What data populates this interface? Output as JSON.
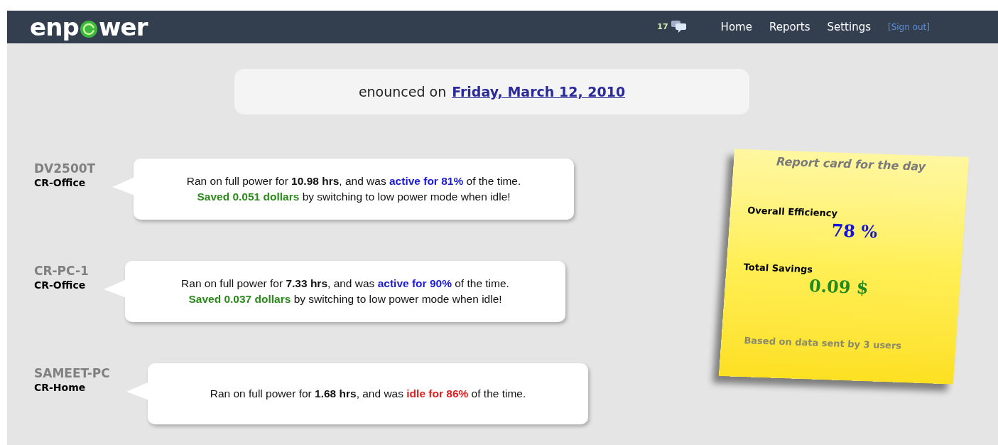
{
  "logo": {
    "before": "enp",
    "after": "wer"
  },
  "nav": {
    "message_count": "17",
    "links": [
      {
        "label": "Home",
        "kind": "main"
      },
      {
        "label": "Reports",
        "kind": "main"
      },
      {
        "label": "Settings",
        "kind": "main"
      },
      {
        "label": "[Sign out]",
        "kind": "signout"
      }
    ]
  },
  "date_banner": {
    "prefix": "enounced on",
    "date": "Friday, March 12, 2010"
  },
  "devices": [
    {
      "name": "DV2500T",
      "location": "CR-Office",
      "lines": [
        [
          {
            "kind": "plain",
            "text": "Ran on full power for "
          },
          {
            "kind": "bold",
            "text": "10.98 hrs"
          },
          {
            "kind": "plain",
            "text": ", and was "
          },
          {
            "kind": "active",
            "text": "active for 81%"
          },
          {
            "kind": "plain",
            "text": " of the time."
          }
        ],
        [
          {
            "kind": "saved",
            "text": "Saved 0.051 dollars"
          },
          {
            "kind": "plain",
            "text": " by switching to low power mode when idle!"
          }
        ]
      ]
    },
    {
      "name": "CR-PC-1",
      "location": "CR-Office",
      "lines": [
        [
          {
            "kind": "plain",
            "text": "Ran on full power for "
          },
          {
            "kind": "bold",
            "text": "7.33 hrs"
          },
          {
            "kind": "plain",
            "text": ", and was "
          },
          {
            "kind": "active",
            "text": "active for 90%"
          },
          {
            "kind": "plain",
            "text": " of the time."
          }
        ],
        [
          {
            "kind": "saved",
            "text": "Saved 0.037 dollars"
          },
          {
            "kind": "plain",
            "text": " by switching to low power mode when idle!"
          }
        ]
      ]
    },
    {
      "name": "SAMEET-PC",
      "location": "CR-Home",
      "lines": [
        [
          {
            "kind": "plain",
            "text": "Ran on full power for "
          },
          {
            "kind": "bold",
            "text": "1.68 hrs"
          },
          {
            "kind": "plain",
            "text": ", and was "
          },
          {
            "kind": "idle",
            "text": "idle for 86%"
          },
          {
            "kind": "plain",
            "text": " of the time."
          }
        ]
      ]
    }
  ],
  "report_card": {
    "title": "Report card for the day",
    "efficiency_label": "Overall Efficiency",
    "efficiency": "78 %",
    "savings_label": "Total Savings",
    "savings": "0.09 $",
    "footnote": "Based on data sent by 3 users"
  }
}
